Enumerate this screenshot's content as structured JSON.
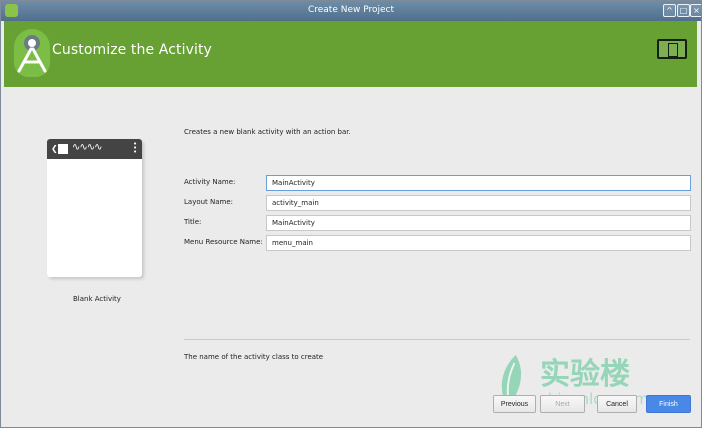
{
  "window": {
    "title": "Create New Project",
    "controls": {
      "minimize": "^",
      "maximize": "□",
      "close": "×"
    }
  },
  "header": {
    "title": "Customize the Activity"
  },
  "preview": {
    "label": "Blank Activity",
    "wave": "∿∿∿∿",
    "back": "❮",
    "dots": "•\n•\n•"
  },
  "main": {
    "description": "Creates a new blank activity with an action bar.",
    "fields": [
      {
        "label": "Activity Name:",
        "value": "MainActivity"
      },
      {
        "label": "Layout Name:",
        "value": "activity_main"
      },
      {
        "label": "Title:",
        "value": "MainActivity"
      },
      {
        "label": "Menu Resource Name:",
        "value": "menu_main"
      }
    ],
    "help": "The name of the activity class to create"
  },
  "watermark": {
    "text": "实验楼",
    "subtext": "shiyanlou.com"
  },
  "buttons": {
    "previous": "Previous",
    "next": "Next",
    "cancel": "Cancel",
    "finish": "Finish"
  },
  "colors": {
    "header": "#67a033",
    "accent": "#4a88e8",
    "watermark": "#68c99d"
  }
}
